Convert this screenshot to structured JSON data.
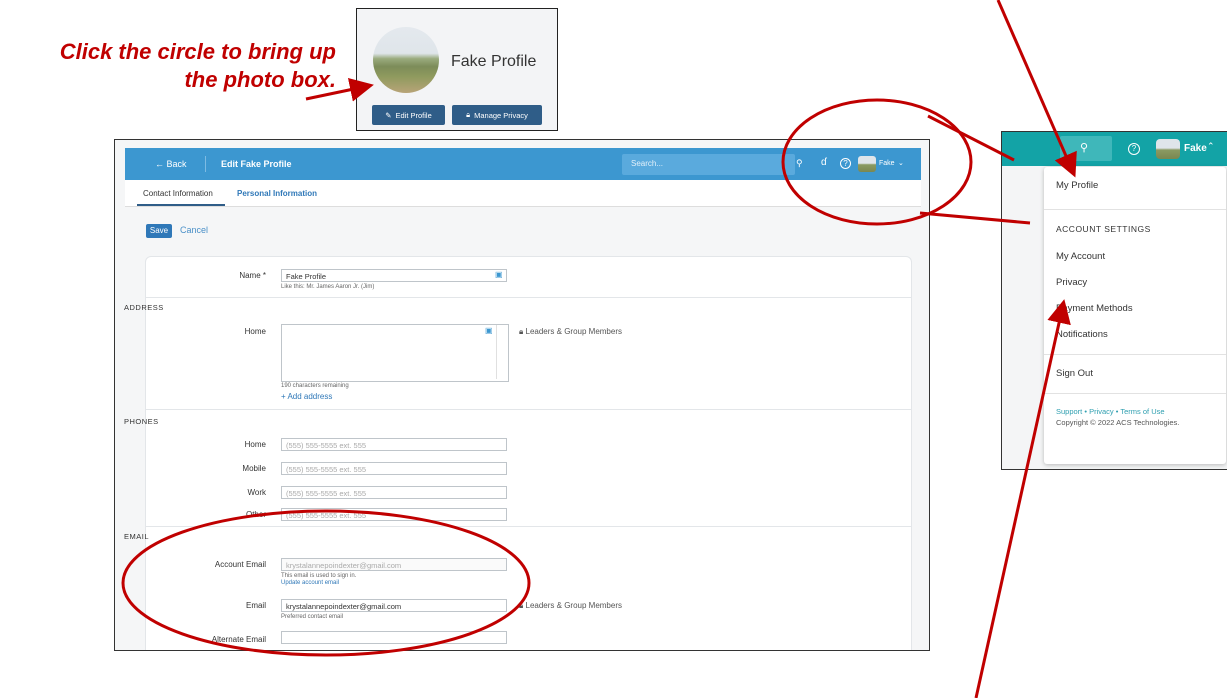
{
  "caption": {
    "line1": "Click the circle to bring up",
    "line2": "the photo box."
  },
  "profile_card": {
    "name": "Fake Profile",
    "edit_button": "Edit Profile",
    "privacy_button": "Manage Privacy"
  },
  "topbar": {
    "back": "← Back",
    "title": "Edit Fake Profile",
    "search_placeholder": "Search...",
    "user": "Fake"
  },
  "tabs": [
    "Contact Information",
    "Personal Information"
  ],
  "actions": {
    "save": "Save",
    "cancel": "Cancel"
  },
  "form": {
    "name_label": "Name *",
    "name_value": "Fake Profile",
    "name_hint": "Like this: Mr. James Aaron Jr. (Jim)",
    "address_section": "ADDRESS",
    "home_label": "Home",
    "chars_remaining": "190 characters remaining",
    "add_address": "+ Add address",
    "visibility": "Leaders & Group Members",
    "phones_section": "PHONES",
    "phones": [
      {
        "label": "Home",
        "placeholder": "(555) 555-5555 ext. 555"
      },
      {
        "label": "Mobile",
        "placeholder": "(555) 555-5555 ext. 555"
      },
      {
        "label": "Work",
        "placeholder": "(555) 555-5555 ext. 555"
      },
      {
        "label": "Other",
        "placeholder": "(555) 555-5555 ext. 555"
      }
    ],
    "email_section": "EMAIL",
    "account_email_label": "Account Email",
    "account_email_value": "krystalannepoindexter@gmail.com",
    "account_email_hint": "This email is used to sign in.",
    "update_account_email": "Update account email",
    "email_label": "Email",
    "email_value": "krystalannepoindexter@gmail.com",
    "email_hint": "Preferred contact email",
    "alternate_email_label": "Alternate Email"
  },
  "dropdown": {
    "user": "Fake",
    "my_profile": "My Profile",
    "account_settings": "ACCOUNT SETTINGS",
    "my_account": "My Account",
    "privacy": "Privacy",
    "payment_methods": "Payment Methods",
    "notifications": "Notifications",
    "sign_out": "Sign Out",
    "support": "Support",
    "privacy_link": "Privacy",
    "terms": "Terms of Use",
    "copyright": "Copyright © 2022 ACS Technologies."
  },
  "colors": {
    "annotation": "#c00000",
    "topbar": "#3c97d0",
    "teal": "#13a3a6",
    "button": "#2f5d88"
  }
}
